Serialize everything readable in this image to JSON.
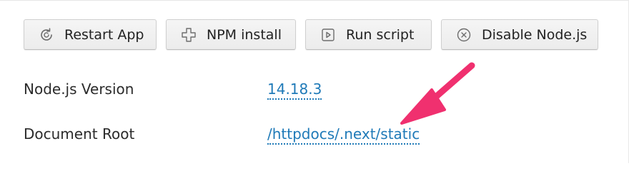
{
  "toolbar": {
    "restart_label": "Restart App",
    "npm_label": "NPM install",
    "run_label": "Run script",
    "disable_label": "Disable Node.js"
  },
  "icons": {
    "restart": "refresh-icon",
    "npm": "plus-outline-icon",
    "run": "play-box-icon",
    "disable": "close-circle-icon"
  },
  "settings": {
    "rows": [
      {
        "label": "Node.js Version",
        "value": "14.18.3"
      },
      {
        "label": "Document Root",
        "value": "/httpdocs/.next/static"
      }
    ]
  },
  "colors": {
    "link": "#1f7ab8",
    "annotation_arrow": "#f0306f",
    "button_bg": "#f0f0f0"
  }
}
